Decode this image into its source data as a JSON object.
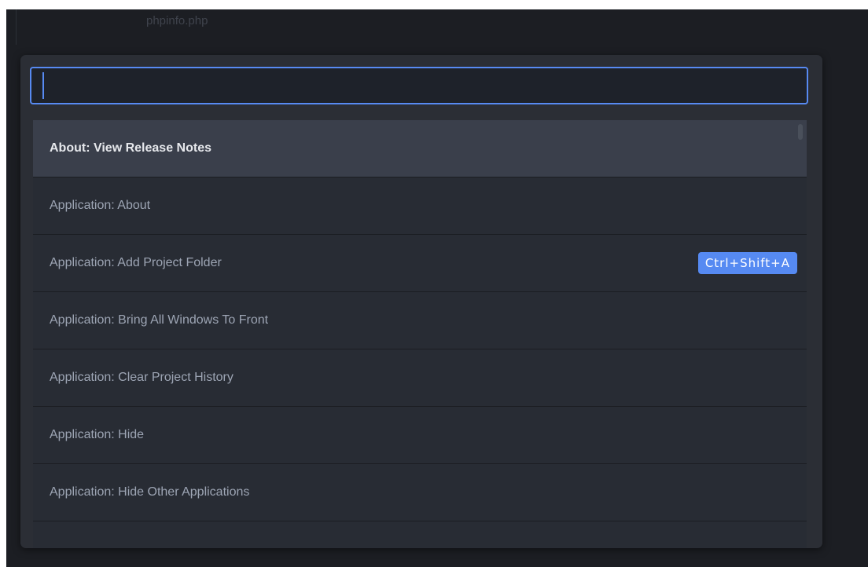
{
  "background": {
    "tab_label": "phpinfo.php"
  },
  "palette": {
    "search": {
      "value": "",
      "placeholder": ""
    },
    "items": [
      {
        "label": "About: View Release Notes",
        "shortcut": "",
        "selected": true
      },
      {
        "label": "Application: About",
        "shortcut": ""
      },
      {
        "label": "Application: Add Project Folder",
        "shortcut": "Ctrl+Shift+A"
      },
      {
        "label": "Application: Bring All Windows To Front",
        "shortcut": ""
      },
      {
        "label": "Application: Clear Project History",
        "shortcut": ""
      },
      {
        "label": "Application: Hide",
        "shortcut": ""
      },
      {
        "label": "Application: Hide Other Applications",
        "shortcut": ""
      },
      {
        "label": "",
        "shortcut": ""
      }
    ]
  },
  "colors": {
    "accent": "#578af2",
    "panel": "#2b2e35",
    "selected_row": "#3a3f4b"
  }
}
